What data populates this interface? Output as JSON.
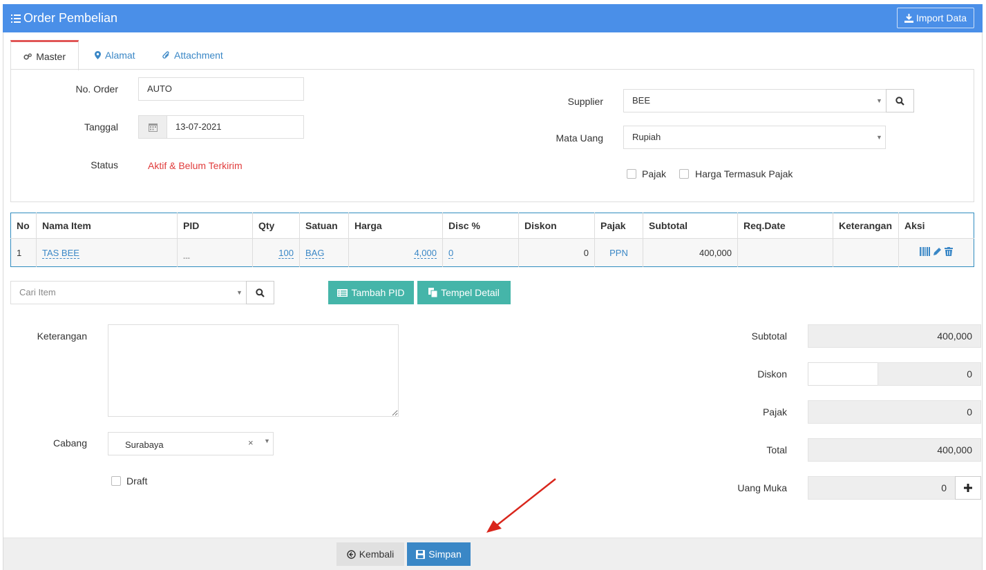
{
  "header": {
    "title": "Order Pembelian",
    "import_label": "Import Data"
  },
  "tabs": [
    {
      "label": "Master",
      "icon": "gears-icon",
      "active": true
    },
    {
      "label": "Alamat",
      "icon": "map-marker-icon",
      "active": false
    },
    {
      "label": "Attachment",
      "icon": "paperclip-icon",
      "active": false
    }
  ],
  "master": {
    "order_no_label": "No. Order",
    "order_no_value": "AUTO",
    "date_label": "Tanggal",
    "date_value": "13-07-2021",
    "status_label": "Status",
    "status_value": "Aktif & Belum Terkirim",
    "supplier_label": "Supplier",
    "supplier_value": "BEE",
    "currency_label": "Mata Uang",
    "currency_value": "Rupiah",
    "tax_label": "Pajak",
    "price_incl_tax_label": "Harga Termasuk Pajak"
  },
  "table": {
    "headers": [
      "No",
      "Nama Item",
      "PID",
      "Qty",
      "Satuan",
      "Harga",
      "Disc %",
      "Diskon",
      "Pajak",
      "Subtotal",
      "Req.Date",
      "Keterangan",
      "Aksi"
    ],
    "rows": [
      {
        "no": "1",
        "item": "TAS BEE",
        "pid": "---",
        "qty": "100",
        "unit": "BAG",
        "price": "4,000",
        "disc_pct": "0",
        "discount": "0",
        "tax": "PPN",
        "subtotal": "400,000",
        "req_date": "",
        "note": ""
      }
    ]
  },
  "actions": {
    "search_item_placeholder": "Cari Item",
    "add_pid_label": "Tambah PID",
    "paste_detail_label": "Tempel Detail"
  },
  "bottom": {
    "note_label": "Keterangan",
    "branch_label": "Cabang",
    "branch_value": "Surabaya",
    "draft_label": "Draft"
  },
  "summary": {
    "subtotal_label": "Subtotal",
    "subtotal_value": "400,000",
    "discount_label": "Diskon",
    "discount_value": "0",
    "tax_label": "Pajak",
    "tax_value": "0",
    "total_label": "Total",
    "total_value": "400,000",
    "dp_label": "Uang Muka",
    "dp_value": "0"
  },
  "footer": {
    "back_label": "Kembali",
    "save_label": "Simpan"
  },
  "colors": {
    "header": "#4a8fe8",
    "teal": "#45b5a9",
    "save": "#3a87c6",
    "status": "#e03b3b",
    "arrow": "#d9261c"
  }
}
